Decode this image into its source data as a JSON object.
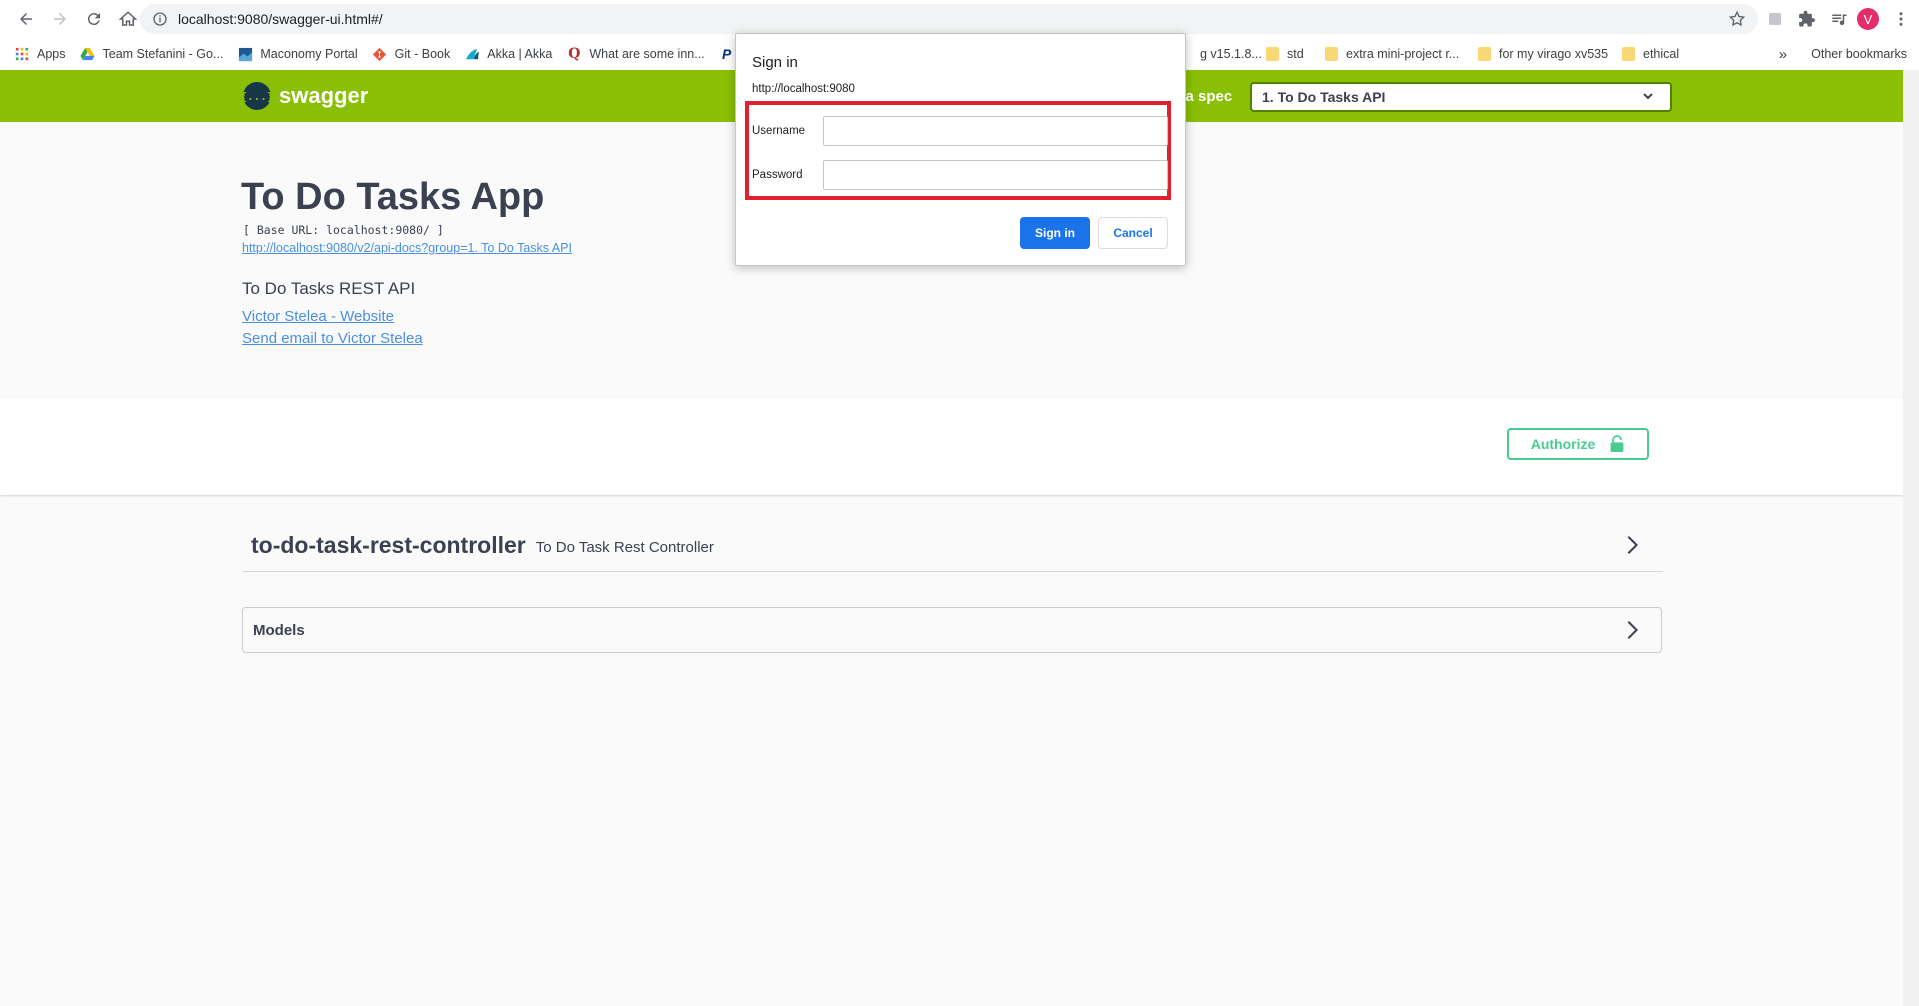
{
  "browser": {
    "url": "localhost:9080/swagger-ui.html#/",
    "avatar_letter": "V",
    "bookmarks": [
      {
        "label": "Apps",
        "icon": "apps-grid-icon"
      },
      {
        "label": "Team Stefanini - Go...",
        "icon": "drive-icon"
      },
      {
        "label": "Maconomy Portal",
        "icon": "maconomy-icon"
      },
      {
        "label": "Git - Book",
        "icon": "git-icon"
      },
      {
        "label": "Akka | Akka",
        "icon": "akka-icon"
      },
      {
        "label": "What are some inn...",
        "icon": "quora-icon"
      },
      {
        "label": "g v15.1.8...",
        "icon": "folder-icon"
      },
      {
        "label": "std",
        "icon": "folder-icon"
      },
      {
        "label": "extra mini-project r...",
        "icon": "folder-icon"
      },
      {
        "label": "for my virago xv535",
        "icon": "folder-icon"
      },
      {
        "label": "ethical",
        "icon": "folder-icon"
      }
    ],
    "more_bookmarks": "»",
    "other_bookmarks": "Other bookmarks"
  },
  "topbar": {
    "logo_mark": "{...}",
    "logo_text": "swagger",
    "spec_label": "ct a spec",
    "spec_selected": "1. To Do Tasks API"
  },
  "info": {
    "title": "To Do Tasks App",
    "base_url": "[ Base URL: localhost:9080/ ]",
    "api_docs_link": "http://localhost:9080/v2/api-docs?group=1. To Do Tasks API",
    "description": "To Do Tasks REST API",
    "contact_links": [
      "Victor Stelea - Website",
      "Send email to Victor Stelea"
    ]
  },
  "scheme": {
    "authorize_label": "Authorize"
  },
  "operations": {
    "tag_name": "to-do-task-rest-controller",
    "tag_description": "To Do Task Rest Controller"
  },
  "models": {
    "title": "Models"
  },
  "dialog": {
    "title": "Sign in",
    "origin": "http://localhost:9080",
    "username_label": "Username",
    "username_value": "",
    "password_label": "Password",
    "password_value": "",
    "signin_label": "Sign in",
    "cancel_label": "Cancel"
  },
  "colors": {
    "swagger_green": "#89bf04",
    "authorize_green": "#49cc90",
    "link_blue": "#4990e2",
    "highlight_red": "#e0202b",
    "chrome_blue": "#1a73e8"
  }
}
